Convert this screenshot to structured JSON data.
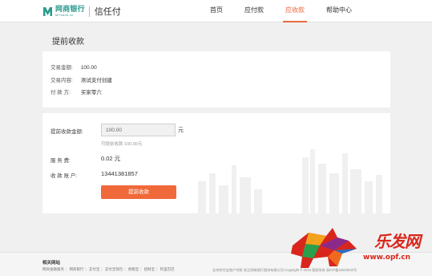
{
  "header": {
    "logo_cn": "网商银行",
    "logo_en": "MYbank.cn",
    "product": "信任付",
    "nav": [
      {
        "label": "首页",
        "active": false
      },
      {
        "label": "应付款",
        "active": false
      },
      {
        "label": "应收款",
        "active": true
      },
      {
        "label": "帮助中心",
        "active": false
      }
    ]
  },
  "page": {
    "title": "提前收款"
  },
  "info": {
    "rows": [
      {
        "label": "交易金额:",
        "value": "100.00"
      },
      {
        "label": "交易内容:",
        "value": "测试支付创建"
      },
      {
        "label": "付 款 方:",
        "value": "买家零六"
      }
    ]
  },
  "form": {
    "amount_label": "提前收款金额:",
    "amount_value": "100.00",
    "amount_unit": "元",
    "hint": "可提前收款 100.00元",
    "fee_label": "服 务 费:",
    "fee_value": "0.02 元",
    "account_label": "收 款 账 户:",
    "account_value": "13441381857",
    "submit_label": "提前收款"
  },
  "footer": {
    "title": "相关网站",
    "links": [
      "网商金融服务",
      "网商银行",
      "支付宝",
      "支付宝钱包",
      "余额宝",
      "招财宝",
      "阿里巴巴"
    ],
    "copyright": "支持余付宝账户付款  浙江网商银行股份有限公司 Copyright © 2015 版权所有 浙ICP备15023032号"
  },
  "watermark": {
    "text": "乐发网",
    "url": "www.opf.cn"
  }
}
